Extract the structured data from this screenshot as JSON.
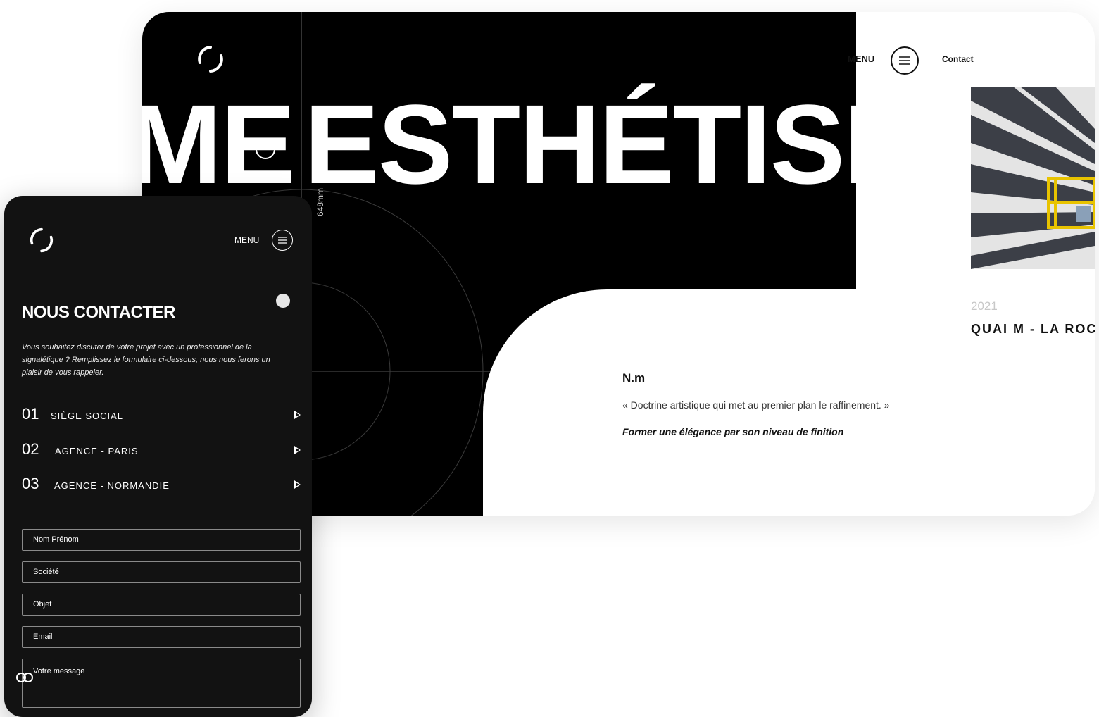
{
  "desktop": {
    "hero_left": "ME",
    "hero_right": "ESTHÉTISME",
    "measure_label": "648mm",
    "menu_label": "MENU",
    "contact_label": "Contact",
    "project": {
      "year": "2021",
      "title": "QUAI M - LA ROCHE"
    },
    "definition": {
      "title": "N.m",
      "quote": "« Doctrine artistique qui met au premier plan le raffinement. »",
      "subtitle": "Former une élégance par son niveau de finition"
    }
  },
  "mobile": {
    "menu_label": "MENU",
    "title": "NOUS CONTACTER",
    "intro": "Vous souhaitez discuter de votre projet avec un professionnel de la signalétique ? Remplissez le formulaire ci-dessous, nous nous ferons un plaisir de vous rappeler.",
    "offices": [
      {
        "num": "01",
        "name": "SIÈGE SOCIAL"
      },
      {
        "num": "02",
        "name": "AGENCE - PARIS"
      },
      {
        "num": "03",
        "name": "AGENCE - NORMANDIE"
      }
    ],
    "form": {
      "name_placeholder": "Nom Prénom",
      "company_placeholder": "Société",
      "subject_placeholder": "Objet",
      "email_placeholder": "Email",
      "message_placeholder": "Votre message"
    }
  },
  "colors": {
    "dark": "#000000",
    "mobile_bg": "#121212",
    "white": "#ffffff"
  },
  "icons": [
    "logo-icon",
    "hamburger-icon",
    "play-arrow-icon",
    "cookie-icon"
  ]
}
